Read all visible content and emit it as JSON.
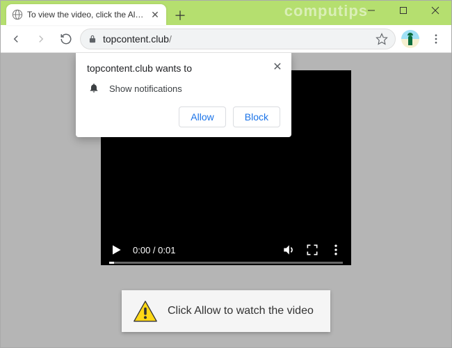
{
  "watermark": "computips",
  "tab": {
    "title": "To view the video, click the Allow"
  },
  "url": {
    "domain": "topcontent.club",
    "path": "/"
  },
  "permission": {
    "title": "topcontent.club wants to",
    "item": "Show notifications",
    "allow": "Allow",
    "block": "Block"
  },
  "video": {
    "time": "0:00 / 0:01"
  },
  "alert": {
    "message": "Click Allow to watch the video"
  }
}
